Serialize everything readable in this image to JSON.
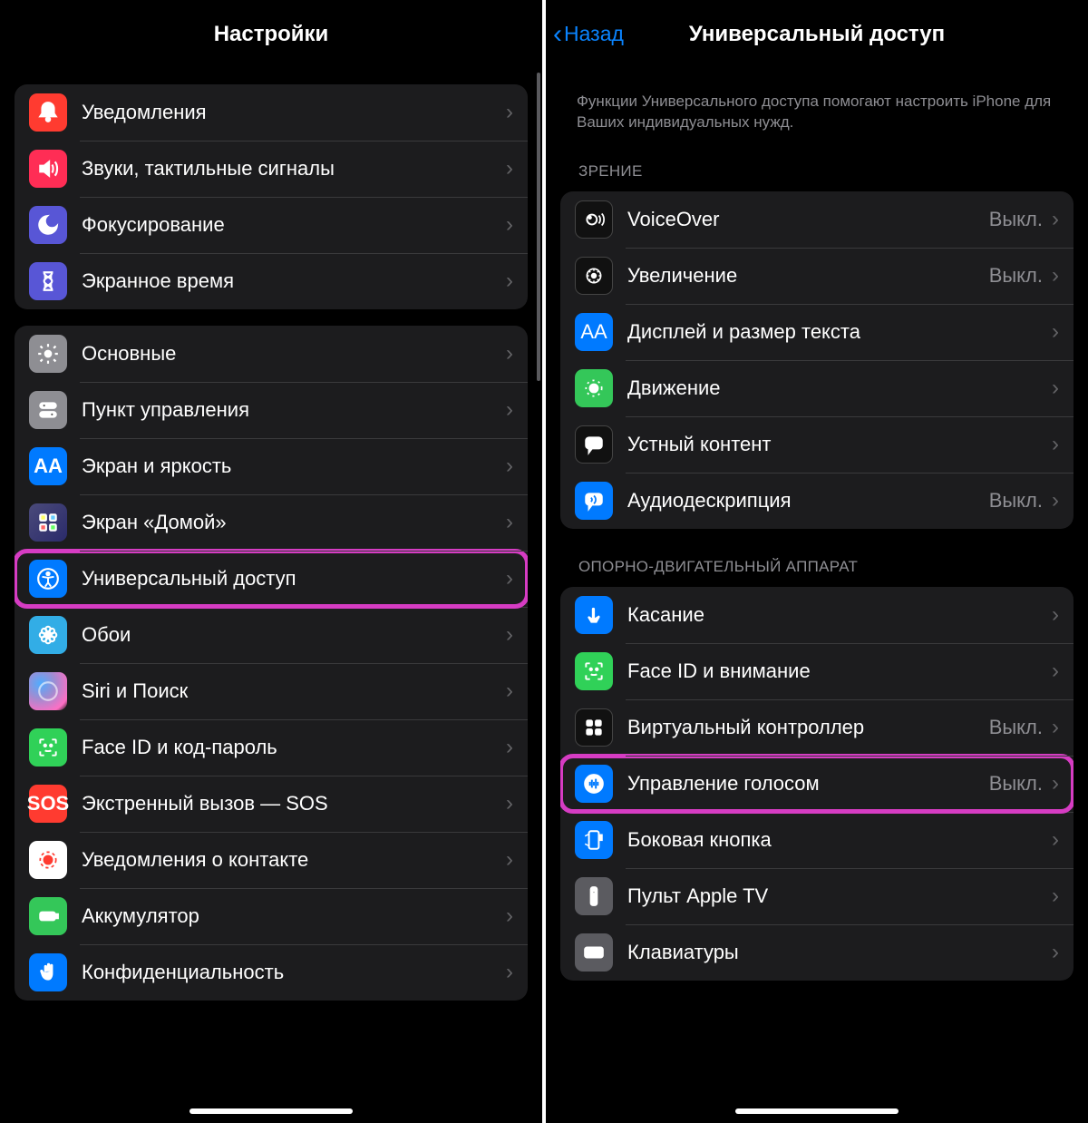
{
  "left": {
    "title": "Настройки",
    "group1": [
      {
        "id": "notifications",
        "label": "Уведомления",
        "icon": "bell-icon",
        "bg": "bg-red"
      },
      {
        "id": "sounds",
        "label": "Звуки, тактильные сигналы",
        "icon": "speaker-icon",
        "bg": "bg-red2"
      },
      {
        "id": "focus",
        "label": "Фокусирование",
        "icon": "moon-icon",
        "bg": "bg-indigo"
      },
      {
        "id": "screentime",
        "label": "Экранное время",
        "icon": "hourglass-icon",
        "bg": "bg-indigo"
      }
    ],
    "group2": [
      {
        "id": "general",
        "label": "Основные",
        "icon": "gear-icon",
        "bg": "bg-gray"
      },
      {
        "id": "controlcenter",
        "label": "Пункт управления",
        "icon": "switches-icon",
        "bg": "bg-gray"
      },
      {
        "id": "display",
        "label": "Экран и яркость",
        "icon": "text-size-icon",
        "bg": "bg-display",
        "glyph": "AA"
      },
      {
        "id": "homescreen",
        "label": "Экран «Домой»",
        "icon": "grid-icon",
        "bg": "bg-home"
      },
      {
        "id": "accessibility",
        "label": "Универсальный доступ",
        "icon": "accessibility-icon",
        "bg": "bg-blue",
        "highlight": true
      },
      {
        "id": "wallpaper",
        "label": "Обои",
        "icon": "flower-icon",
        "bg": "bg-cyan"
      },
      {
        "id": "siri",
        "label": "Siri и Поиск",
        "icon": "siri-icon",
        "bg": "bg-siri"
      },
      {
        "id": "faceid",
        "label": "Face ID и код-пароль",
        "icon": "faceid-icon",
        "bg": "bg-green"
      },
      {
        "id": "sos",
        "label": "Экстренный вызов — SOS",
        "icon": "sos-icon",
        "bg": "bg-sos",
        "glyph": "SOS"
      },
      {
        "id": "exposure",
        "label": "Уведомления о контакте",
        "icon": "exposure-icon",
        "bg": "bg-contact"
      },
      {
        "id": "battery",
        "label": "Аккумулятор",
        "icon": "battery-icon",
        "bg": "bg-green2"
      },
      {
        "id": "privacy",
        "label": "Конфиденциальность",
        "icon": "hand-icon",
        "bg": "bg-privacy"
      }
    ]
  },
  "right": {
    "back": "Назад",
    "title": "Универсальный доступ",
    "description": "Функции Универсального доступа помогают настроить iPhone для Ваших индивидуальных нужд.",
    "sections": [
      {
        "header": "ЗРЕНИЕ",
        "rows": [
          {
            "id": "voiceover",
            "label": "VoiceOver",
            "value": "Выкл.",
            "icon": "voiceover-icon",
            "bg": "bg-black"
          },
          {
            "id": "zoom",
            "label": "Увеличение",
            "value": "Выкл.",
            "icon": "zoom-icon",
            "bg": "bg-black"
          },
          {
            "id": "textsize",
            "label": "Дисплей и размер текста",
            "icon": "text-size-icon",
            "bg": "bg-blue",
            "glyph": "AA"
          },
          {
            "id": "motion",
            "label": "Движение",
            "icon": "motion-icon",
            "bg": "bg-green2"
          },
          {
            "id": "spoken",
            "label": "Устный контент",
            "icon": "speech-icon",
            "bg": "bg-black"
          },
          {
            "id": "audiodesc",
            "label": "Аудиодескрипция",
            "value": "Выкл.",
            "icon": "audio-desc-icon",
            "bg": "bg-blue"
          }
        ]
      },
      {
        "header": "ОПОРНО-ДВИГАТЕЛЬНЫЙ АППАРАТ",
        "rows": [
          {
            "id": "touch",
            "label": "Касание",
            "icon": "touch-icon",
            "bg": "bg-blue"
          },
          {
            "id": "faceattention",
            "label": "Face ID и внимание",
            "icon": "faceid-icon",
            "bg": "bg-green"
          },
          {
            "id": "switchcontrol",
            "label": "Виртуальный контроллер",
            "value": "Выкл.",
            "icon": "grid4-icon",
            "bg": "bg-black"
          },
          {
            "id": "voicecontrol",
            "label": "Управление голосом",
            "value": "Выкл.",
            "icon": "voice-control-icon",
            "bg": "bg-blue",
            "highlight": true
          },
          {
            "id": "sidebutton",
            "label": "Боковая кнопка",
            "icon": "side-button-icon",
            "bg": "bg-blue"
          },
          {
            "id": "appletv",
            "label": "Пульт Apple TV",
            "icon": "remote-icon",
            "bg": "bg-gray2"
          },
          {
            "id": "keyboards",
            "label": "Клавиатуры",
            "icon": "keyboard-icon",
            "bg": "bg-gray2"
          }
        ]
      }
    ]
  }
}
